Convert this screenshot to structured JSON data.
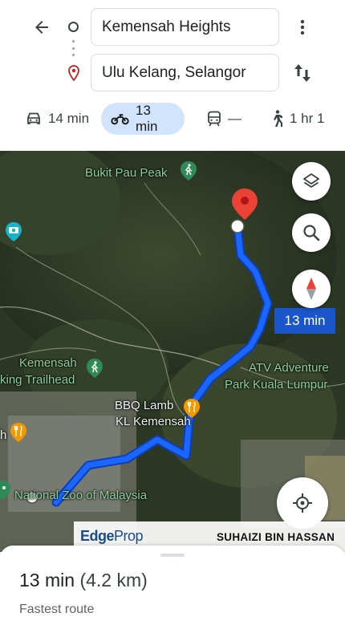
{
  "search": {
    "origin": "Kemensah Heights",
    "destination": "Ulu Kelang, Selangor"
  },
  "icons": {
    "back": "arrow-left-icon",
    "origin": "origin-circle-icon",
    "destination": "destination-pin-icon",
    "more": "more-vert-icon",
    "swap": "swap-vert-icon",
    "car": "car-icon",
    "motorcycle": "motorcycle-icon",
    "transit": "train-icon",
    "walk": "walking-icon",
    "layers": "layers-icon",
    "search": "search-icon",
    "compass": "compass-icon",
    "locate": "my-location-icon"
  },
  "modes": [
    {
      "id": "car",
      "label": "14 min",
      "selected": false
    },
    {
      "id": "motorcycle",
      "label": "13 min",
      "selected": true
    },
    {
      "id": "transit",
      "label": "—",
      "selected": false
    },
    {
      "id": "walk",
      "label": "1 hr 1",
      "selected": false
    }
  ],
  "map": {
    "labels": {
      "bukit_pau": "Bukit Pau Peak",
      "kemensah": "Kemensah",
      "trailhead": "king Trailhead",
      "atv1": "ATV Adventure",
      "atv2": "Park Kuala Lumpur",
      "bbq1": "BBQ Lamb",
      "bbq2": "KL Kemensah",
      "zoo": "National Zoo of Malaysia",
      "edge_h": "h"
    },
    "route_time": "13 min",
    "colors": {
      "route": "#1a66ff",
      "route_chip": "#1a55c9",
      "selected_mode": "#d2e3fc",
      "pin": "#ea4335"
    }
  },
  "watermark": {
    "brand_edge": "Edge",
    "brand_prop": "Prop",
    "name": "SUHAIZI BIN HASSAN"
  },
  "sheet": {
    "duration": "13 min",
    "distance": "(4.2 km)",
    "subtitle": "Fastest route"
  }
}
